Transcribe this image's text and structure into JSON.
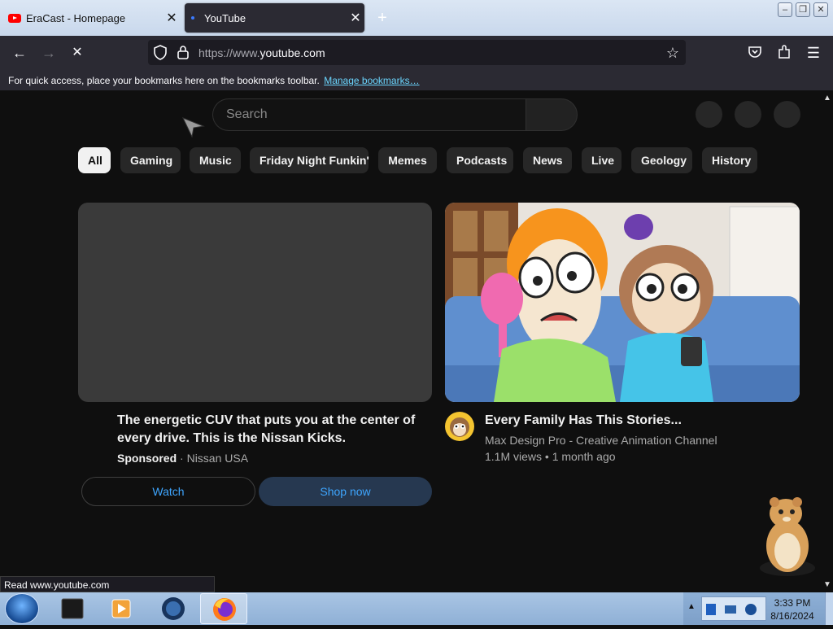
{
  "browser": {
    "tabs": [
      {
        "label": "EraCast - Homepage",
        "active": false
      },
      {
        "label": "YouTube",
        "active": true
      }
    ],
    "new_tab_label": "+",
    "url_prefix": "https://www.",
    "url_domain": "youtube.com",
    "bookmarks_hint": "For quick access, place your bookmarks here on the bookmarks toolbar.",
    "manage_bookmarks": "Manage bookmarks…",
    "status": "Read www.youtube.com"
  },
  "youtube": {
    "search_placeholder": "Search",
    "chips": [
      "All",
      "Gaming",
      "Music",
      "Friday Night Funkin'",
      "Memes",
      "Podcasts",
      "News",
      "Live",
      "Geology",
      "History"
    ],
    "ad": {
      "title": "The energetic CUV that puts you at the center of every drive. This is the Nissan Kicks.",
      "sponsored": "Sponsored",
      "advertiser": "Nissan USA",
      "watch": "Watch",
      "shop": "Shop now"
    },
    "video": {
      "title": "Every Family Has This Stories...",
      "channel": "Max Design Pro - Creative Animation Channel",
      "stats": "1.1M views • 1 month ago"
    }
  },
  "taskbar": {
    "time": "3:33 PM",
    "date": "8/16/2024"
  },
  "colors": {
    "youtube_bg": "#0f0f0f",
    "chip_bg": "#272727",
    "link_blue": "#3ea6ff",
    "firefox_chrome": "#2b2a33"
  }
}
